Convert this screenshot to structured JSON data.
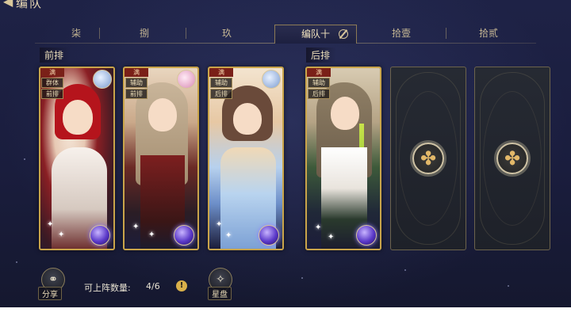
{
  "header": {
    "title": "编队",
    "back_icon": "back-arrow-icon"
  },
  "tabs": [
    {
      "label": "柒",
      "active": false
    },
    {
      "label": "捌",
      "active": false
    },
    {
      "label": "玖",
      "active": false
    },
    {
      "label": "编队十",
      "active": true,
      "icon": "edit-icon"
    },
    {
      "label": "拾壹",
      "active": false
    },
    {
      "label": "拾贰",
      "active": false
    }
  ],
  "sections": {
    "front": "前排",
    "back": "后排"
  },
  "cards": [
    {
      "full_tag": "满",
      "role": "群体",
      "row": "前排",
      "element_icon": "wind-bird-icon"
    },
    {
      "full_tag": "满",
      "role": "辅助",
      "row": "前排",
      "element_icon": "rabbit-icon"
    },
    {
      "full_tag": "满",
      "role": "辅助",
      "row": "后排",
      "element_icon": "bird-icon"
    },
    {
      "full_tag": "满",
      "role": "辅助",
      "row": "后排",
      "element_icon": ""
    }
  ],
  "empty_slots": 2,
  "bottom": {
    "share_label": "分享",
    "capacity_label": "可上阵数量:",
    "capacity_value": "4/6",
    "info_icon": "!",
    "starchart_label": "星盘"
  },
  "colors": {
    "gold": "#c9a44a",
    "bg": "#1c1f42",
    "accent_purple": "#5a38c8"
  }
}
